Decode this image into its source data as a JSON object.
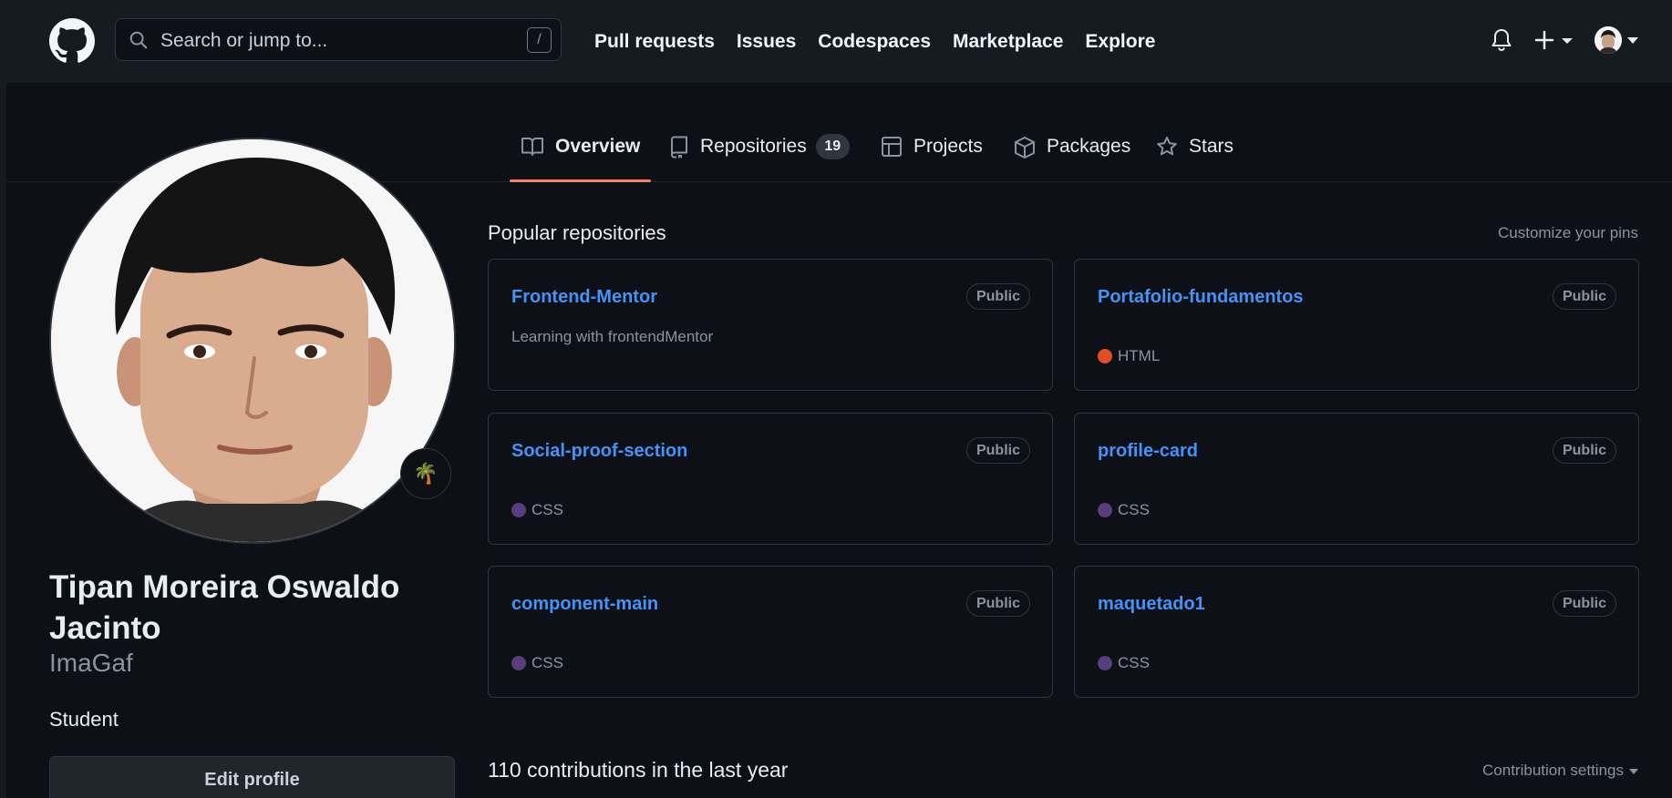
{
  "header": {
    "search_placeholder": "Search or jump to...",
    "search_shortcut": "/",
    "nav": [
      "Pull requests",
      "Issues",
      "Codespaces",
      "Marketplace",
      "Explore"
    ]
  },
  "tabs": {
    "overview": "Overview",
    "repositories": "Repositories",
    "repositories_count": "19",
    "projects": "Projects",
    "packages": "Packages",
    "stars": "Stars"
  },
  "profile": {
    "status_emoji": "🌴",
    "full_name": "Tipan Moreira Oswaldo Jacinto",
    "login": "ImaGaf",
    "bio": "Student",
    "edit_button": "Edit profile"
  },
  "popular": {
    "title": "Popular repositories",
    "customize": "Customize your pins",
    "repos": [
      {
        "name": "Frontend-Mentor",
        "visibility": "Public",
        "description": "Learning with frontendMentor",
        "language": "",
        "lang_color": ""
      },
      {
        "name": "Portafolio-fundamentos",
        "visibility": "Public",
        "description": "",
        "language": "HTML",
        "lang_color": "#e34c26"
      },
      {
        "name": "Social-proof-section",
        "visibility": "Public",
        "description": "",
        "language": "CSS",
        "lang_color": "#563d7c"
      },
      {
        "name": "profile-card",
        "visibility": "Public",
        "description": "",
        "language": "CSS",
        "lang_color": "#563d7c"
      },
      {
        "name": "component-main",
        "visibility": "Public",
        "description": "",
        "language": "CSS",
        "lang_color": "#563d7c"
      },
      {
        "name": "maquetado1",
        "visibility": "Public",
        "description": "",
        "language": "CSS",
        "lang_color": "#563d7c"
      }
    ]
  },
  "contributions": {
    "title": "110 contributions in the last year",
    "settings": "Contribution settings"
  },
  "colors": {
    "accent_link": "#4493f8",
    "tab_underline": "#f78166"
  }
}
